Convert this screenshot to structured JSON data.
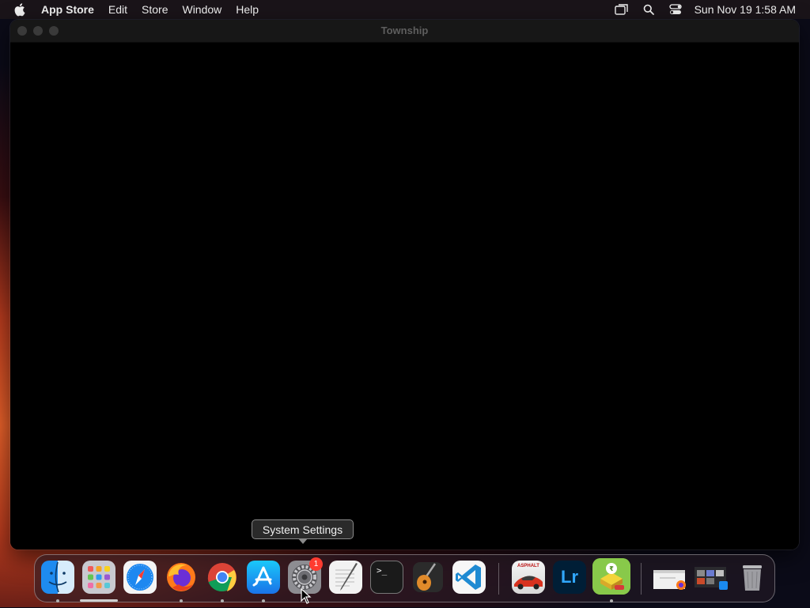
{
  "menubar": {
    "app_name": "App Store",
    "items": [
      "Edit",
      "Store",
      "Window",
      "Help"
    ],
    "status_icons": [
      "screen-mirroring-icon",
      "search-icon",
      "control-center-icon"
    ],
    "clock": "Sun Nov 19  1:58 AM"
  },
  "window": {
    "title": "Township"
  },
  "tooltip": {
    "text": "System Settings"
  },
  "dock": {
    "apps": [
      {
        "name": "Finder",
        "icon": "finder-icon",
        "running": true
      },
      {
        "name": "Launchpad",
        "icon": "launchpad-icon",
        "running": false
      },
      {
        "name": "Safari",
        "icon": "safari-icon",
        "running": false
      },
      {
        "name": "Firefox",
        "icon": "firefox-icon",
        "running": true
      },
      {
        "name": "Google Chrome",
        "icon": "chrome-icon",
        "running": true
      },
      {
        "name": "App Store",
        "icon": "app-store-icon",
        "running": true
      },
      {
        "name": "System Settings",
        "icon": "system-settings-icon",
        "running": false,
        "badge": "1"
      },
      {
        "name": "TextEdit",
        "icon": "textedit-icon",
        "running": false
      },
      {
        "name": "Terminal",
        "icon": "terminal-icon",
        "running": false
      },
      {
        "name": "GarageBand",
        "icon": "garageband-icon",
        "running": false
      },
      {
        "name": "Visual Studio Code",
        "icon": "vscode-icon",
        "running": false
      },
      {
        "name": "Asphalt",
        "icon": "asphalt-icon",
        "running": false
      },
      {
        "name": "Lightroom",
        "icon": "lightroom-icon",
        "running": false
      },
      {
        "name": "Township",
        "icon": "township-icon",
        "running": true
      },
      {
        "name": "Downloads",
        "icon": "downloads-stack-icon",
        "running": false
      },
      {
        "name": "Screenshots",
        "icon": "screenshots-stack-icon",
        "running": false
      },
      {
        "name": "Trash",
        "icon": "trash-icon",
        "running": false
      }
    ],
    "asphalt_label": "ASPHALT",
    "lightroom_label": "Lr",
    "terminal_prompt": ">_"
  },
  "colors": {
    "badge": "#ff3b30",
    "window_bg": "#000000",
    "vscode": "#1f8ad2",
    "lightroom_bg": "#001e36"
  }
}
